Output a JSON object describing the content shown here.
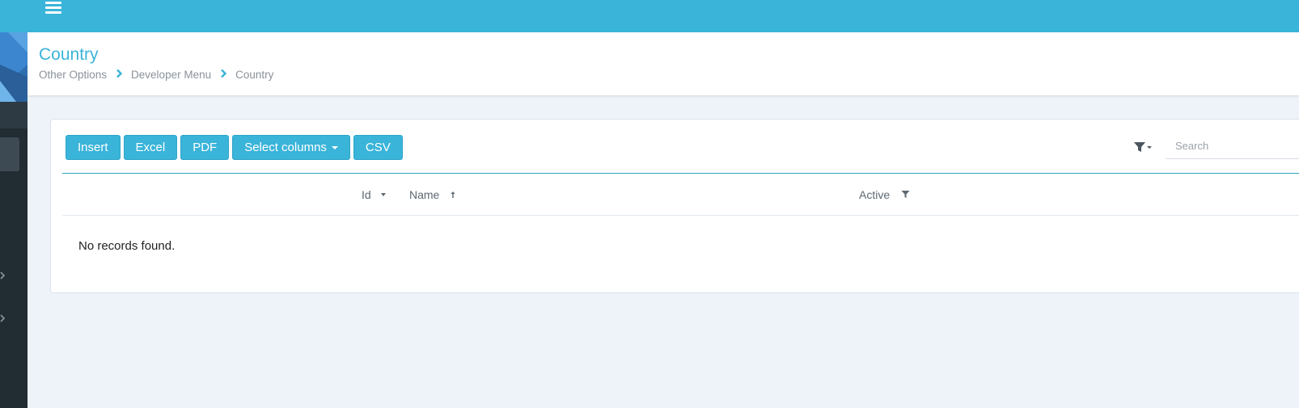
{
  "header": {
    "menu_icon": "hamburger-icon"
  },
  "page": {
    "title": "Country",
    "breadcrumb": [
      "Other Options",
      "Developer Menu",
      "Country"
    ],
    "separator_icon": "chevron-right-icon"
  },
  "toolbar": {
    "insert_label": "Insert",
    "excel_label": "Excel",
    "pdf_label": "PDF",
    "select_columns_label": "Select columns",
    "csv_label": "CSV",
    "filter_icon": "filter-icon"
  },
  "search": {
    "placeholder": "Search"
  },
  "table": {
    "columns": [
      {
        "label": "Id",
        "indicator": "sort-desc-icon"
      },
      {
        "label": "Name",
        "indicator": "sort-asc-icon"
      },
      {
        "label": "Active",
        "indicator": "filter-icon"
      }
    ],
    "empty_message": "No records found."
  },
  "colors": {
    "accent": "#3ab4d9",
    "sidebar": "#222c33",
    "background": "#edf3f8"
  }
}
